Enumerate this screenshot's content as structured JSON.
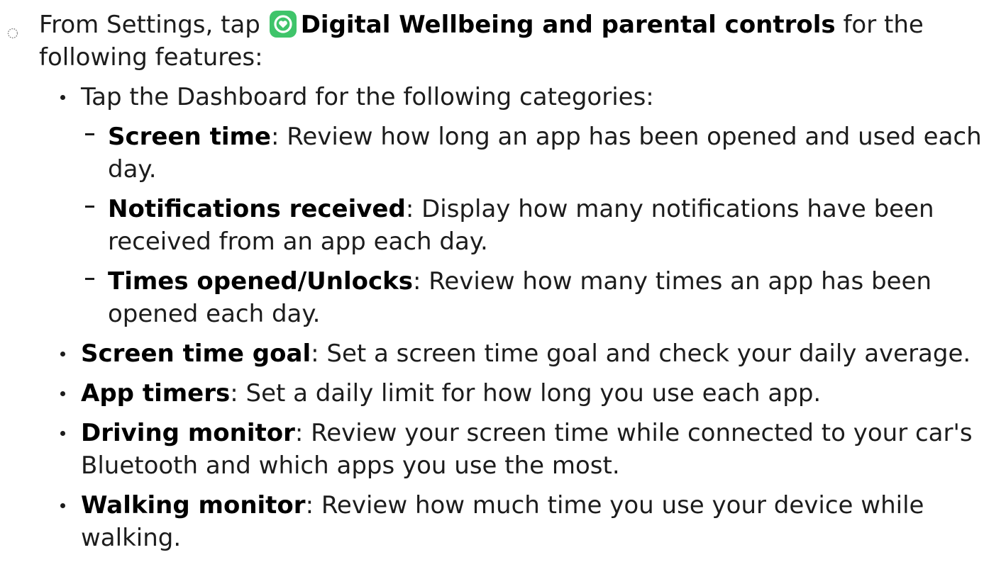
{
  "intro": {
    "prefix": "From Settings, tap",
    "app_name": "Digital Wellbeing and parental controls",
    "suffix": " for the following features:",
    "icon": "digital-wellbeing-app-icon",
    "icon_color": "#3fc46a"
  },
  "dashboard": {
    "text": "Tap the Dashboard for the following categories:",
    "categories": [
      {
        "term": "Screen time",
        "sep": ": ",
        "desc": "Review how long an app has been opened and used each day."
      },
      {
        "term": "Notifications received",
        "sep": ": ",
        "desc": "Display how many notifications have been received from an app each day."
      },
      {
        "term": "Times opened/Unlocks",
        "sep": ": ",
        "desc": "Review how many times an app has been opened each day."
      }
    ]
  },
  "features": [
    {
      "term": "Screen time goal",
      "sep": ": ",
      "desc": "Set a screen time goal and check your daily average."
    },
    {
      "term": "App timers",
      "sep": ": ",
      "desc": "Set a daily limit for how long you use each app."
    },
    {
      "term": "Driving monitor",
      "sep": ": ",
      "desc": "Review your screen time while connected to your car's Bluetooth and which apps you use the most."
    },
    {
      "term": "Walking monitor",
      "sep": ": ",
      "desc": "Review how much time you use your device while walking."
    }
  ]
}
